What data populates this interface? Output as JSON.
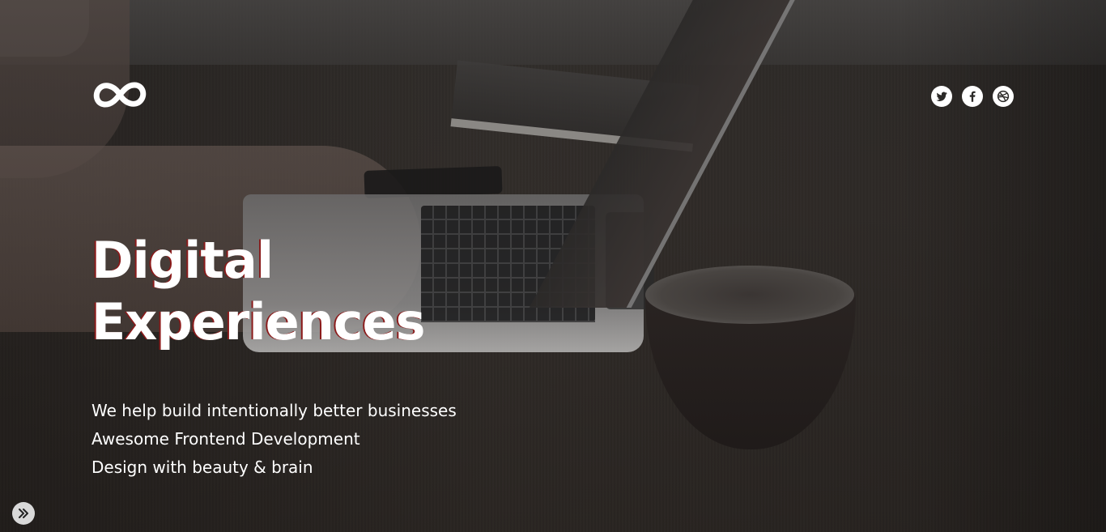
{
  "brand": {
    "logo_icon": "infinity-logo-icon"
  },
  "social": [
    {
      "icon": "twitter-bird-icon",
      "label": "Twitter"
    },
    {
      "icon": "facebook-icon",
      "label": "Facebook"
    },
    {
      "icon": "dribbble-icon",
      "label": "Dribbble"
    }
  ],
  "hero": {
    "headline_line1": "Digital",
    "headline_line2": "Experiences",
    "taglines": [
      "We help build intentionally better businesses",
      "Awesome Frontend Development",
      "Design with beauty & brain"
    ]
  },
  "scroll_button": {
    "icon": "double-chevron-right-icon"
  },
  "colors": {
    "text": "#ffffff",
    "headline_shadow": "#8b1a1a",
    "overlay": "#2b2927",
    "scroll_button_bg": "#d9d9d9"
  }
}
